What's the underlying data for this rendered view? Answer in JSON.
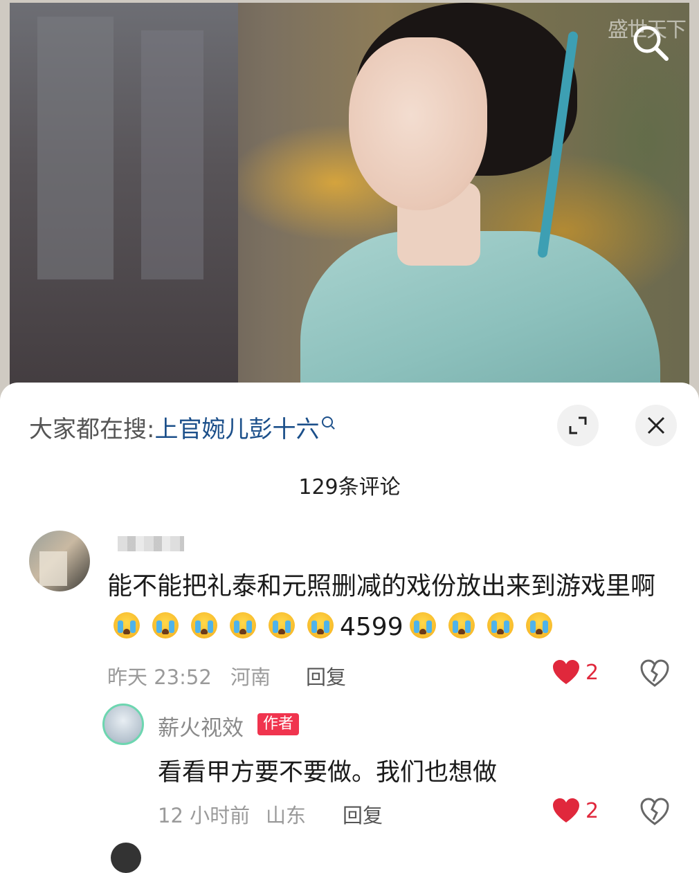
{
  "hero": {
    "watermark": "盛世天下",
    "search_icon": "search-icon"
  },
  "sheet": {
    "search_prefix": "大家都在搜:",
    "search_keyword": "上官婉儿彭十六",
    "expand_icon": "expand-icon",
    "close_icon": "close-icon",
    "comment_count": "129条评论"
  },
  "comments": [
    {
      "text_part1": "能不能把礼泰和元照删减的戏份放出来到游戏里啊",
      "text_number": "4599",
      "time": "昨天 23:52",
      "location": "河南",
      "reply_label": "回复",
      "likes": "2"
    }
  ],
  "reply": {
    "username": "薪火视效",
    "badge": "作者",
    "text": "看看甲方要不要做。我们也想做",
    "time": "12 小时前",
    "location": "山东",
    "reply_label": "回复",
    "likes": "2"
  },
  "colors": {
    "like_red": "#e0283c",
    "keyword_blue": "#1b4f8a",
    "author_badge": "#f0344e"
  }
}
